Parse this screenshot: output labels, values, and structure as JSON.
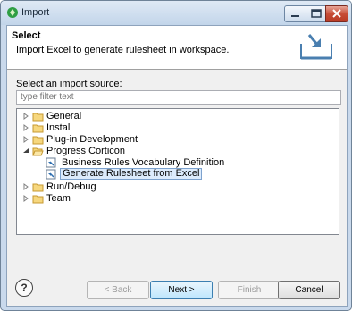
{
  "window": {
    "title": "Import"
  },
  "banner": {
    "title": "Select",
    "description": "Import Excel to generate rulesheet in workspace."
  },
  "source": {
    "label": "Select an import source:",
    "filter_placeholder": "type filter text"
  },
  "tree": {
    "general": "General",
    "install": "Install",
    "plugin": "Plug-in Development",
    "corticon": "Progress Corticon",
    "vocab": "Business Rules Vocabulary Definition",
    "generate": "Generate Rulesheet from Excel",
    "rundebug": "Run/Debug",
    "team": "Team"
  },
  "buttons": {
    "help": "?",
    "back": "< Back",
    "next": "Next >",
    "finish": "Finish",
    "cancel": "Cancel"
  }
}
